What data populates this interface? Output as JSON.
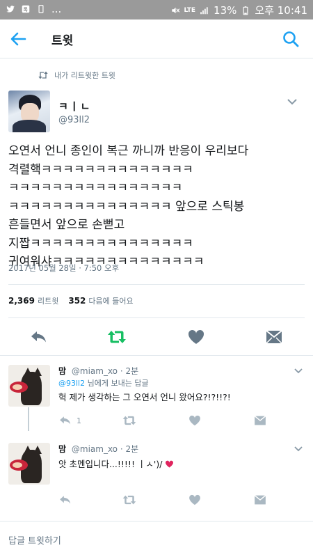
{
  "status_bar": {
    "app_icons": [
      "twitter-icon",
      "messenger-icon",
      "sim-icon",
      "more-icon"
    ],
    "ellipsis": "...",
    "network": "LTE",
    "battery": "13%",
    "time": "오후 10:41"
  },
  "header": {
    "title": "트윗"
  },
  "retweet_context": {
    "label": "내가 리트윗한 트윗"
  },
  "tweet": {
    "author_name": "ㅋㅣㄴ",
    "author_handle": "@93ll2",
    "lines": [
      "오연서 언니 종인이 복근 까니까 반응이 우리보다",
      "격렬핵ㅋㅋㅋㅋㅋㅋㅋㅋㅋㅋㅋㅋㅋㅋ",
      "ㅋㅋㅋㅋㅋㅋㅋㅋㅋㅋㅋㅋㅋㅋㅋㅋ",
      "ㅋㅋㅋㅋㅋㅋㅋㅋㅋㅋㅋㅋㅋㅋㅋ 앞으로 스틱봉",
      "흔들면서 앞으로 손뻗고",
      "지짭ㅋㅋㅋㅋㅋㅋㅋㅋㅋㅋㅋㅋㅋㅋㅋ",
      "귀여워샤ㅋㅋㅋㅋㅋㅋㅋㅋㅋㅋㅋㅋㅋㅋ"
    ],
    "timestamp": "2017년 05월 28일 · 7:50 오후",
    "retweet_count": "2,369",
    "retweet_label": "리트윗",
    "like_count": "352",
    "like_label": "다음에 들어요"
  },
  "replies": [
    {
      "display_name": "맘",
      "handle": "@miam_xo",
      "time": "· 2분",
      "reply_prefix": "@93ll2",
      "reply_suffix": " 님에게 보내는 답글",
      "text": "헉 제가 생각하는 그 오연서 언니 왔어요?!?!!?!",
      "reply_count": "1"
    },
    {
      "display_name": "맘",
      "handle": "@miam_xo",
      "time": "· 2분",
      "text": "앗 초멘입니다...!!!!! ㅣㅅ')/"
    }
  ],
  "reply_bar": {
    "placeholder": "답글 트윗하기"
  },
  "colors": {
    "accent": "#1da1f2",
    "retweet_green": "#17bf63",
    "heart_red": "#e0245e",
    "icon_gray": "#657786"
  }
}
